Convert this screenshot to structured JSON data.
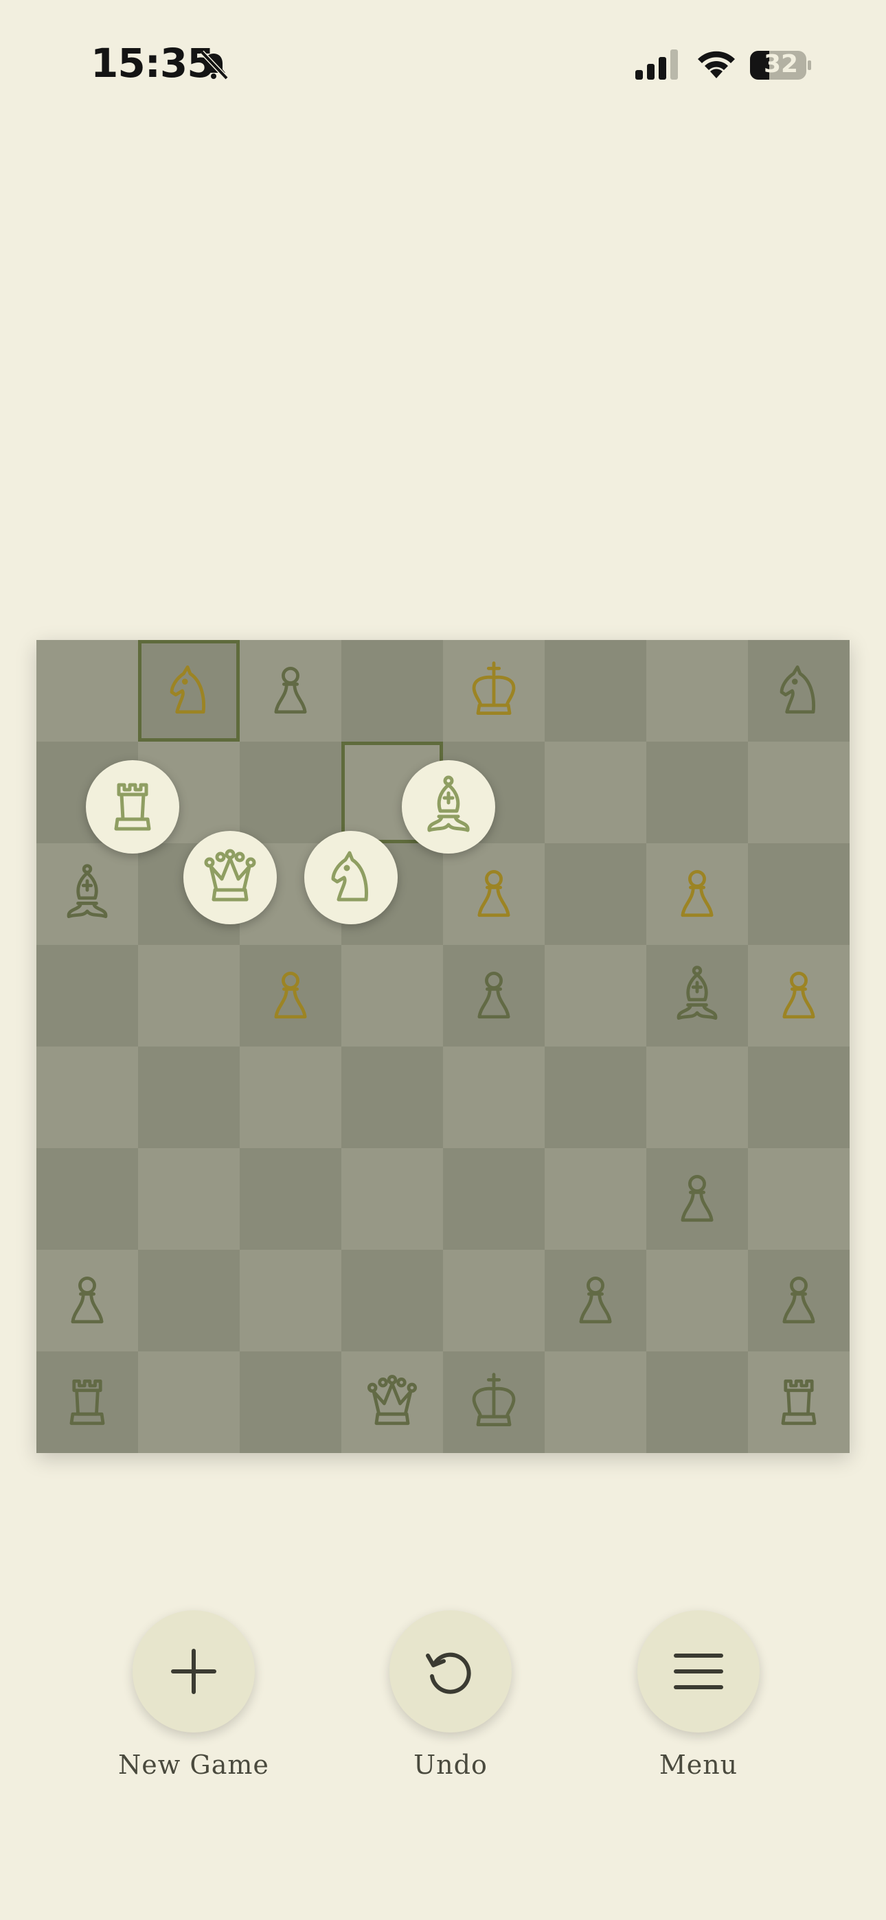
{
  "status_bar": {
    "time": "15:35",
    "battery": "32",
    "icons": [
      "bell-slash-icon",
      "cellular-signal-icon",
      "wifi-icon",
      "battery-icon"
    ]
  },
  "board": {
    "light_square_color": "#979886",
    "dark_square_color": "#898b79",
    "dark_piece_color": "#626a45",
    "gold_piece_color": "#9c8424",
    "pieces": [
      {
        "square": "b8",
        "type": "knight",
        "color": "gold"
      },
      {
        "square": "c8",
        "type": "pawn",
        "color": "dark"
      },
      {
        "square": "e8",
        "type": "king",
        "color": "gold"
      },
      {
        "square": "h8",
        "type": "knight",
        "color": "dark"
      },
      {
        "square": "a6",
        "type": "bishop",
        "color": "dark"
      },
      {
        "square": "e6",
        "type": "pawn",
        "color": "gold"
      },
      {
        "square": "g6",
        "type": "pawn",
        "color": "gold"
      },
      {
        "square": "c5",
        "type": "pawn",
        "color": "gold"
      },
      {
        "square": "e5",
        "type": "pawn",
        "color": "dark"
      },
      {
        "square": "g5",
        "type": "bishop",
        "color": "dark"
      },
      {
        "square": "h5",
        "type": "pawn",
        "color": "gold"
      },
      {
        "square": "g3",
        "type": "pawn",
        "color": "dark"
      },
      {
        "square": "a2",
        "type": "pawn",
        "color": "dark"
      },
      {
        "square": "f2",
        "type": "pawn",
        "color": "dark"
      },
      {
        "square": "h2",
        "type": "pawn",
        "color": "dark"
      },
      {
        "square": "a1",
        "type": "rook",
        "color": "dark"
      },
      {
        "square": "d1",
        "type": "queen",
        "color": "dark"
      },
      {
        "square": "e1",
        "type": "king",
        "color": "dark"
      },
      {
        "square": "h1",
        "type": "rook",
        "color": "dark"
      }
    ],
    "highlighted_squares": [
      "b8",
      "d7"
    ],
    "promotion_choices": [
      "rook",
      "bishop",
      "queen",
      "knight"
    ]
  },
  "controls": {
    "new_game": {
      "label": "New Game",
      "icon": "plus-icon"
    },
    "undo": {
      "label": "Undo",
      "icon": "undo-icon"
    },
    "menu": {
      "label": "Menu",
      "icon": "hamburger-menu-icon"
    }
  }
}
